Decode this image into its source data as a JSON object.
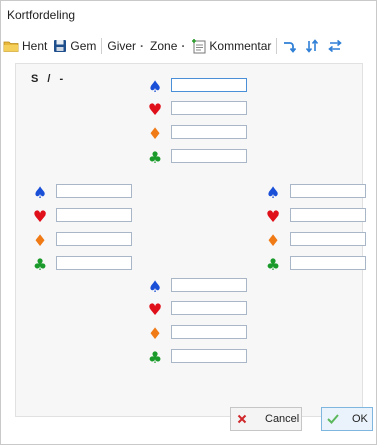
{
  "window": {
    "title": "Kortfordeling"
  },
  "toolbar": {
    "load_label": "Hent",
    "save_label": "Gem",
    "dealer_label": "Giver",
    "zone_label": "Zone",
    "comment_label": "Kommentar"
  },
  "deal_info": {
    "dealer_zone": "S / -"
  },
  "hands": {
    "north": {
      "spades": "",
      "hearts": "",
      "diamonds": "",
      "clubs": ""
    },
    "west": {
      "spades": "",
      "hearts": "",
      "diamonds": "",
      "clubs": ""
    },
    "east": {
      "spades": "",
      "hearts": "",
      "diamonds": "",
      "clubs": ""
    },
    "south": {
      "spades": "",
      "hearts": "",
      "diamonds": "",
      "clubs": ""
    }
  },
  "suit_symbols": {
    "spades": "♠",
    "hearts": "♥",
    "diamonds": "♦",
    "clubs": "♣"
  },
  "buttons": {
    "cancel_label": "Cancel",
    "ok_label": "OK"
  },
  "colors": {
    "spades": "#1a4fd8",
    "hearts": "#e0101a",
    "diamonds": "#f07a15",
    "clubs": "#1a9a2a"
  }
}
